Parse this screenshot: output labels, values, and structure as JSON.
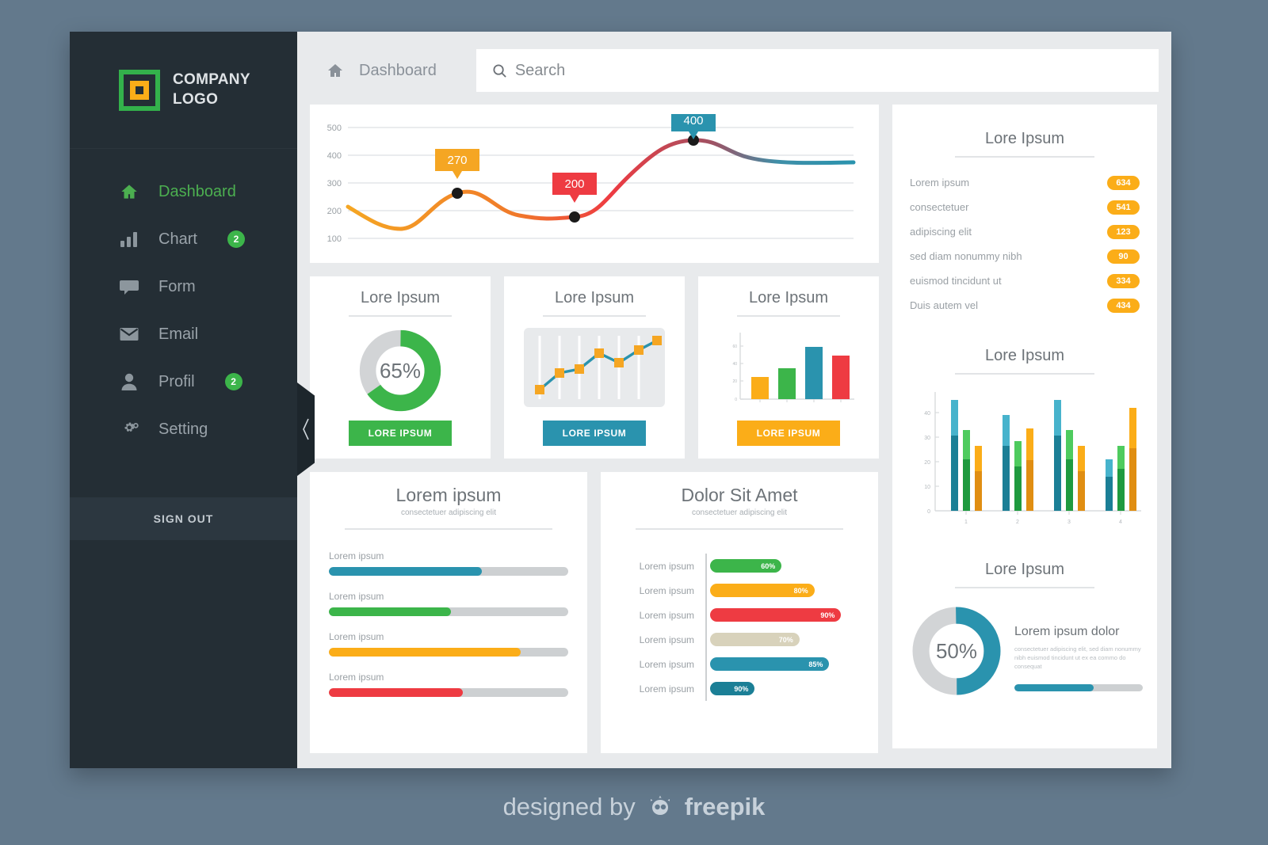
{
  "theme": {
    "page_bg": "#63798c",
    "sidebar_bg": "#242e35",
    "content_bg": "#e8eaec",
    "accent_green": "#3cb54a",
    "accent_orange": "#fbad18",
    "accent_teal": "#2a93ae",
    "accent_red": "#ee3b42"
  },
  "sidebar": {
    "logo": {
      "line1": "COMPANY",
      "line2": "LOGO",
      "icon": "square-logo-icon"
    },
    "items": [
      {
        "label": "Dashboard",
        "icon": "home-icon",
        "badge": "",
        "active": true
      },
      {
        "label": "Chart",
        "icon": "bar-chart-icon",
        "badge": "2",
        "active": false
      },
      {
        "label": "Form",
        "icon": "comment-icon",
        "badge": "",
        "active": false
      },
      {
        "label": "Email",
        "icon": "envelope-icon",
        "badge": "",
        "active": false
      },
      {
        "label": "Profil",
        "icon": "user-icon",
        "badge": "2",
        "active": false
      },
      {
        "label": "Setting",
        "icon": "gear-icon",
        "badge": "",
        "active": false
      }
    ],
    "signout_label": "SIGN OUT",
    "collapse_icon": "chevron-left-icon"
  },
  "topbar": {
    "home_icon": "home-icon",
    "breadcrumb": "Dashboard",
    "search_icon": "search-icon",
    "search_placeholder": "Search",
    "search_value": ""
  },
  "list_card": {
    "title": "Lore Ipsum",
    "rows": [
      {
        "label": "Lorem ipsum",
        "value": "634"
      },
      {
        "label": "consectetuer",
        "value": "541"
      },
      {
        "label": "adipiscing elit",
        "value": "123"
      },
      {
        "label": "sed diam nonummy nibh",
        "value": "90"
      },
      {
        "label": "euismod tincidunt ut",
        "value": "334"
      },
      {
        "label": "Duis autem vel",
        "value": "434"
      }
    ]
  },
  "widgets": [
    {
      "title": "Lore Ipsum",
      "button": "LORE IPSUM",
      "button_color": "#3cb54a",
      "type": "donut",
      "percent": "65%"
    },
    {
      "title": "Lore Ipsum",
      "button": "LORE IPSUM",
      "button_color": "#2a93ae",
      "type": "sparkline"
    },
    {
      "title": "Lore Ipsum",
      "button": "LORE IPSUM",
      "button_color": "#fbad18",
      "type": "bars"
    }
  ],
  "progress_card": {
    "title": "Lorem ipsum",
    "subtitle": "consectetuer adipiscing elit",
    "rows": [
      {
        "label": "Lorem ipsum",
        "percent": 64,
        "color": "#2a93ae"
      },
      {
        "label": "Lorem ipsum",
        "percent": 51,
        "color": "#3cb54a"
      },
      {
        "label": "Lorem ipsum",
        "percent": 80,
        "color": "#fbad18"
      },
      {
        "label": "Lorem ipsum",
        "percent": 56,
        "color": "#ee3b42"
      }
    ]
  },
  "hbar_card": {
    "title": "Dolor Sit Amet",
    "subtitle": "consectetuer adipiscing elit",
    "rows": [
      {
        "label": "Lorem ipsum",
        "value": "60%",
        "percent": 48,
        "color": "#3cb54a"
      },
      {
        "label": "Lorem ipsum",
        "value": "80%",
        "percent": 70,
        "color": "#fbad18"
      },
      {
        "label": "Lorem ipsum",
        "value": "90%",
        "percent": 88,
        "color": "#ee3b42"
      },
      {
        "label": "Lorem ipsum",
        "value": "70%",
        "percent": 60,
        "color": "#d8d2bb"
      },
      {
        "label": "Lorem ipsum",
        "value": "85%",
        "percent": 80,
        "color": "#2a93ae"
      },
      {
        "label": "Lorem ipsum",
        "value": "90%",
        "percent": 30,
        "color": "#1b7f96"
      }
    ]
  },
  "barchart_card": {
    "title": "Lore Ipsum"
  },
  "donut_card": {
    "title": "Lore Ipsum",
    "percent": "50%",
    "heading": "Lorem ipsum dolor",
    "body": "consectetuer adipiscing elit, sed diam nonummy nibh euismod tincidunt ut  ex ea commo do consequat",
    "mini_percent": 62
  },
  "footer": {
    "text": "designed by",
    "brand": "freepik",
    "icon": "freepik-mascot-icon"
  },
  "chart_data": [
    {
      "type": "line",
      "id": "main-line-chart",
      "title": "",
      "x": [
        0,
        1,
        2,
        3,
        4,
        5,
        6,
        7,
        8
      ],
      "values": [
        215,
        168,
        230,
        270,
        240,
        200,
        330,
        405,
        360
      ],
      "ylim": [
        50,
        520
      ],
      "yticks": [
        100,
        200,
        300,
        400,
        500
      ],
      "grid": true,
      "markers": [
        {
          "x": 3,
          "y": 270,
          "label": "270",
          "color": "#f5a623"
        },
        {
          "x": 5,
          "y": 200,
          "label": "200",
          "color": "#ee3b42"
        },
        {
          "x": 7,
          "y": 400,
          "label": "400",
          "color": "#2a93ae"
        }
      ],
      "line_gradient": [
        "#f5a623",
        "#ee3b42",
        "#2a93ae"
      ]
    },
    {
      "type": "pie",
      "id": "widget-donut",
      "title": "Lore Ipsum",
      "labels": [
        "value",
        "rest"
      ],
      "values": [
        65,
        35
      ],
      "colors": [
        "#3cb54a",
        "#d2d4d6"
      ],
      "center_label": "65%"
    },
    {
      "type": "line",
      "id": "widget-sparkline",
      "title": "Lore Ipsum",
      "x": [
        1,
        2,
        3,
        4,
        5,
        6,
        7
      ],
      "values": [
        18,
        42,
        48,
        72,
        58,
        76,
        92
      ],
      "ylim": [
        0,
        100
      ],
      "color": "#2a93ae",
      "marker_color": "#f5a623",
      "grid": true
    },
    {
      "type": "bar",
      "id": "widget-bars",
      "title": "Lore Ipsum",
      "categories": [
        "1",
        "2",
        "3",
        "4"
      ],
      "values": [
        25,
        35,
        60,
        50
      ],
      "colors": [
        "#fbad18",
        "#3cb54a",
        "#2a93ae",
        "#ee3b42"
      ],
      "ylim": [
        0,
        70
      ],
      "yticks": [
        0,
        20,
        40,
        60
      ]
    },
    {
      "type": "bar",
      "id": "sidebar-grouped-bars",
      "title": "Lore Ipsum",
      "categories": [
        "1",
        "2",
        "3",
        "4"
      ],
      "ylim": [
        0,
        48
      ],
      "yticks": [
        0,
        10,
        20,
        30,
        40
      ],
      "stacked": true,
      "series": [
        {
          "name": "teal-dark",
          "values": [
            30.5,
            26.5,
            30.5,
            14
          ],
          "color": "#1b7f96"
        },
        {
          "name": "teal-light",
          "values": [
            45,
            39,
            45,
            21
          ],
          "color": "#47b3cc"
        },
        {
          "name": "green-dark",
          "values": [
            21,
            18,
            21,
            17
          ],
          "color": "#1f9a3f"
        },
        {
          "name": "green-light",
          "values": [
            33,
            28.5,
            33,
            26.5
          ],
          "color": "#4ecb5e"
        },
        {
          "name": "orange-dark",
          "values": [
            16,
            20.5,
            16,
            25.5
          ],
          "color": "#e08e12"
        },
        {
          "name": "orange-light",
          "values": [
            26.5,
            33.5,
            26.5,
            42
          ],
          "color": "#fbad18"
        }
      ]
    },
    {
      "type": "pie",
      "id": "sidebar-donut",
      "title": "Lore Ipsum",
      "labels": [
        "value",
        "rest"
      ],
      "values": [
        50,
        50
      ],
      "colors": [
        "#2a93ae",
        "#d2d4d6"
      ],
      "center_label": "50%"
    },
    {
      "type": "bar",
      "id": "progress-bars",
      "title": "Lorem ipsum",
      "categories": [
        "Lorem ipsum",
        "Lorem ipsum",
        "Lorem ipsum",
        "Lorem ipsum"
      ],
      "values": [
        64,
        51,
        80,
        56
      ],
      "colors": [
        "#2a93ae",
        "#3cb54a",
        "#fbad18",
        "#ee3b42"
      ],
      "ylim": [
        0,
        100
      ],
      "orientation": "horizontal"
    },
    {
      "type": "bar",
      "id": "dolor-hbars",
      "title": "Dolor Sit Amet",
      "categories": [
        "Lorem ipsum",
        "Lorem ipsum",
        "Lorem ipsum",
        "Lorem ipsum",
        "Lorem ipsum",
        "Lorem ipsum"
      ],
      "values": [
        60,
        80,
        90,
        70,
        85,
        90
      ],
      "colors": [
        "#3cb54a",
        "#fbad18",
        "#ee3b42",
        "#d8d2bb",
        "#2a93ae",
        "#1b7f96"
      ],
      "ylim": [
        0,
        100
      ],
      "orientation": "horizontal"
    }
  ]
}
